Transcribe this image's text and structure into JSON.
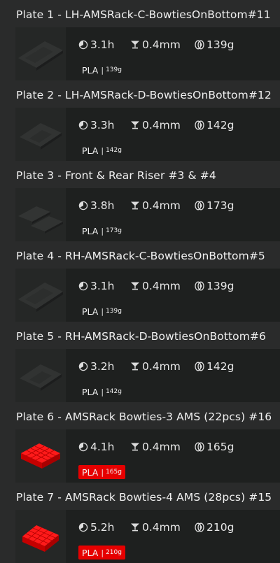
{
  "plates": [
    {
      "title": "Plate 1 - LH-AMSRack-C-BowtiesOnBottom#11",
      "time": "3.1h",
      "layer": "0.4mm",
      "weight": "139g",
      "filament": {
        "type": "PLA",
        "weight": "139g",
        "highlight": false
      },
      "thumb": "grey"
    },
    {
      "title": "Plate 2 - LH-AMSRack-D-BowtiesOnBottom#12",
      "time": "3.3h",
      "layer": "0.4mm",
      "weight": "142g",
      "filament": {
        "type": "PLA",
        "weight": "142g",
        "highlight": false
      },
      "thumb": "grey"
    },
    {
      "title": "Plate 3 - Front & Rear Riser #3 & #4",
      "time": "3.8h",
      "layer": "0.4mm",
      "weight": "173g",
      "filament": {
        "type": "PLA",
        "weight": "173g",
        "highlight": false
      },
      "thumb": "grey"
    },
    {
      "title": "Plate 4 - RH-AMSRack-C-BowtiesOnBottom#5",
      "time": "3.1h",
      "layer": "0.4mm",
      "weight": "139g",
      "filament": {
        "type": "PLA",
        "weight": "139g",
        "highlight": false
      },
      "thumb": "grey"
    },
    {
      "title": "Plate 5 - RH-AMSRack-D-BowtiesOnBottom#6",
      "time": "3.2h",
      "layer": "0.4mm",
      "weight": "142g",
      "filament": {
        "type": "PLA",
        "weight": "142g",
        "highlight": false
      },
      "thumb": "grey"
    },
    {
      "title": "Plate 6 - AMSRack Bowties-3 AMS (22pcs) #16",
      "time": "4.1h",
      "layer": "0.4mm",
      "weight": "165g",
      "filament": {
        "type": "PLA",
        "weight": "165g",
        "highlight": true
      },
      "thumb": "red"
    },
    {
      "title": "Plate 7 - AMSRack Bowties-4 AMS (28pcs) #15",
      "time": "5.2h",
      "layer": "0.4mm",
      "weight": "210g",
      "filament": {
        "type": "PLA",
        "weight": "210g",
        "highlight": true
      },
      "thumb": "red"
    }
  ],
  "icons": {
    "time": "clock-icon",
    "layer": "layer-height-icon",
    "weight": "filament-spool-icon"
  },
  "colors": {
    "background": "#2a2b2b",
    "card": "#1e201f",
    "highlight": "#e60000"
  }
}
